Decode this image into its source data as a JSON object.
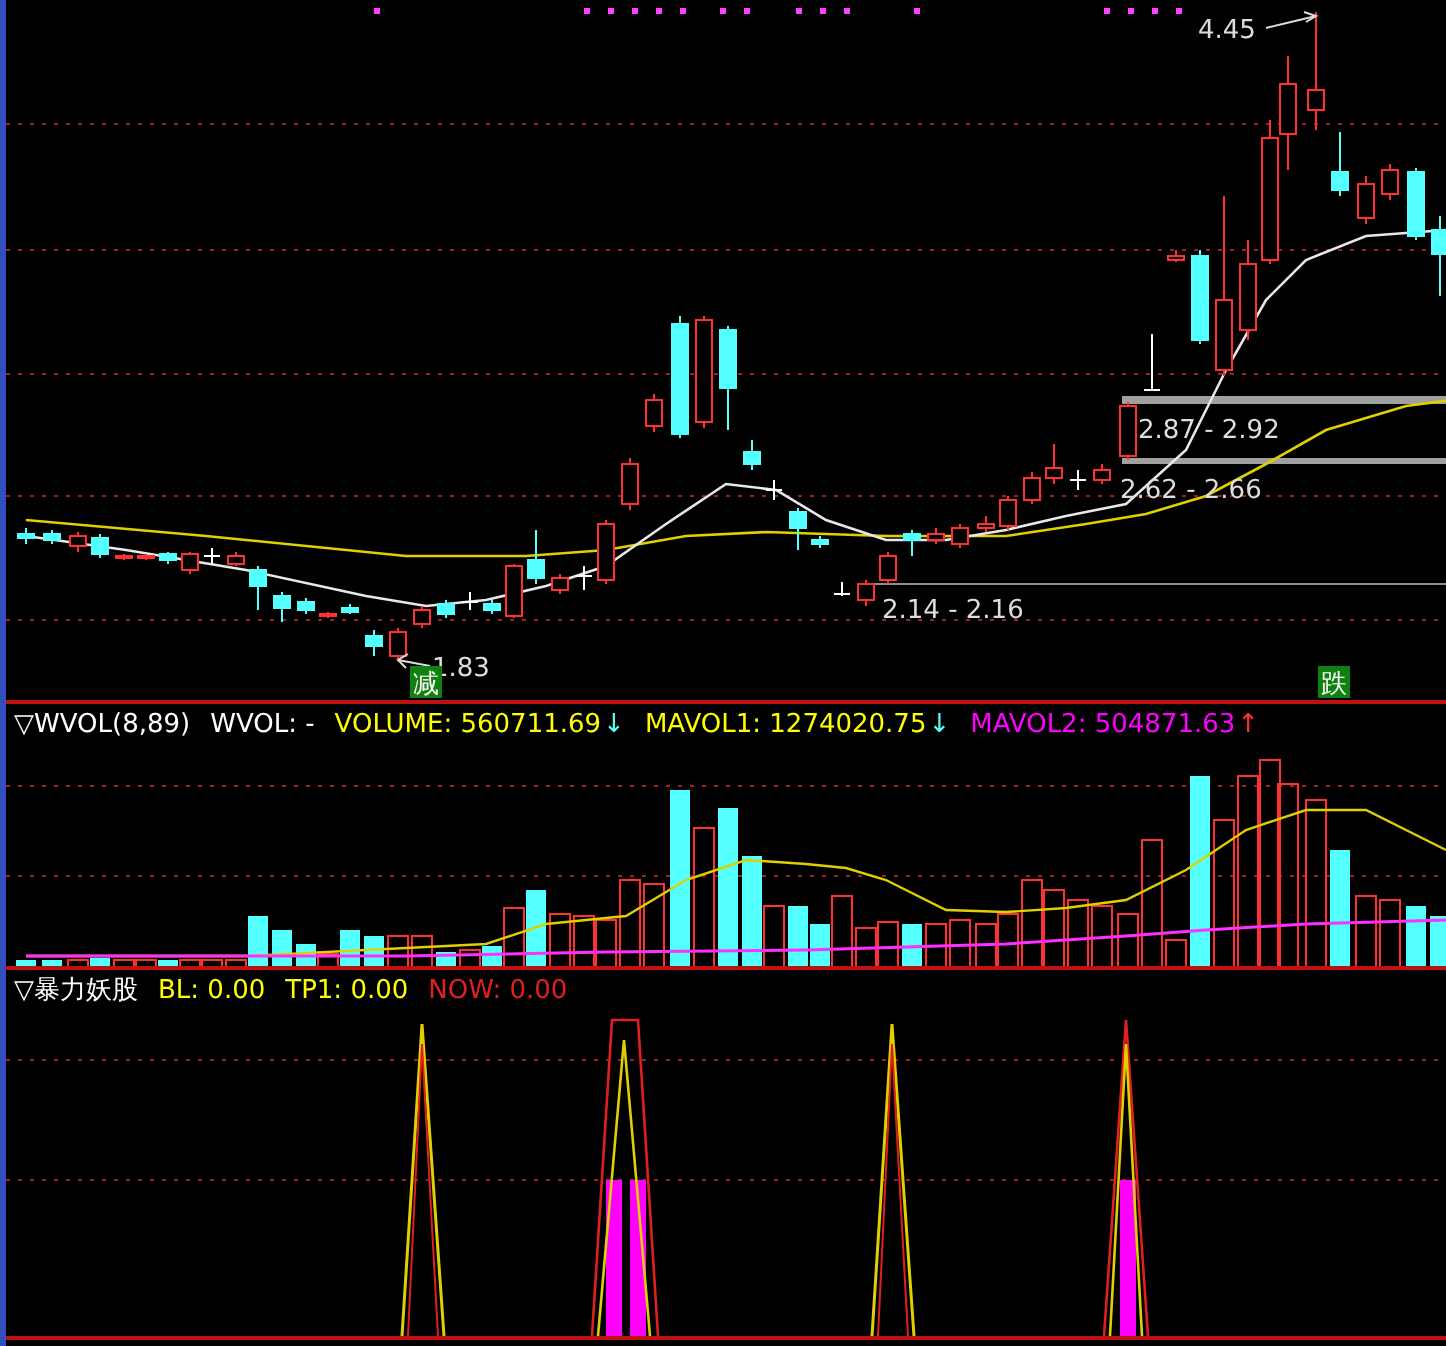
{
  "price_panel": {
    "high_label": "4.45",
    "low_label": "1.83",
    "range_labels": [
      "2.87 - 2.92",
      "2.62 - 2.66",
      "2.14 - 2.16"
    ],
    "signals": [
      {
        "text": "减"
      },
      {
        "text": "跌"
      }
    ]
  },
  "volume_panel": {
    "marker": "▽",
    "name": "WVOL(8,89)",
    "values": [
      {
        "text": "WVOL: -",
        "color": "#ffffff"
      },
      {
        "text": "VOLUME: 560711.69",
        "color": "#ffff00",
        "arrow": {
          "text": "↓",
          "color": "#54ffff"
        }
      },
      {
        "text": "MAVOL1: 1274020.75",
        "color": "#ffff00",
        "arrow": {
          "text": "↓",
          "color": "#54ffff"
        }
      },
      {
        "text": "MAVOL2: 504871.63",
        "color": "#ff00ff",
        "arrow": {
          "text": "↑",
          "color": "#ff3030"
        }
      }
    ]
  },
  "indicator_panel": {
    "marker": "▽",
    "name": "暴力妖股",
    "values": [
      {
        "text": "BL: 0.00",
        "color": "#ffff00"
      },
      {
        "text": "TP1: 0.00",
        "color": "#ffff00"
      },
      {
        "text": "NOW: 0.00",
        "color": "#e02020"
      }
    ]
  }
}
